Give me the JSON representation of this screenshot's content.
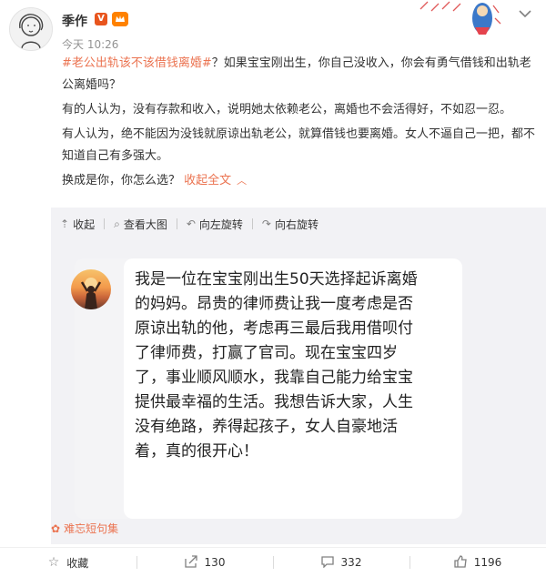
{
  "post": {
    "username": "季作",
    "badge_verified": "V",
    "badge_member": "会员",
    "timestamp": "今天 10:26",
    "topic_tag": "#老公出轨该不该借钱离婚#",
    "para1_rest": "？如果宝宝刚出生，你自己没收入，你会有勇气借钱和出轨老公离婚吗？",
    "para2": "有的人认为，没有存款和收入，说明她太依赖老公，离婚也不会活得好，不如忍一忍。",
    "para3": "有人认为，绝不能因为没钱就原谅出轨老公，就算借钱也要离婚。女人不逼自己一把，都不知道自己有多强大。",
    "para4_prefix": "换成是你，你怎么选？",
    "collapse_link": "收起全文",
    "collapse_icon": "chevron-up-icon"
  },
  "media_toolbar": {
    "collapse": "收起",
    "view_large": "查看大图",
    "rotate_left": "向左旋转",
    "rotate_right": "向右旋转"
  },
  "image_card": {
    "message": "我是一位在宝宝刚出生50天选择起诉离婚\n的妈妈。昂贵的律师费让我一度考虑是否\n原谅出轨的他，考虑再三最后我用借呗付\n了律师费，打赢了官司。现在宝宝四岁\n了，事业顺风顺水，我靠自己能力给宝宝\n提供最幸福的生活。我想告诉大家，人生\n没有绝路，养得起孩子，女人自豪地活\n着，真的很开心！"
  },
  "collection": {
    "label": "难忘短句集",
    "icon": "flower-icon"
  },
  "actions": [
    {
      "label": "收藏",
      "icon": "star-icon"
    },
    {
      "label": "130",
      "icon": "share-icon"
    },
    {
      "label": "332",
      "icon": "comment-icon"
    },
    {
      "label": "1196",
      "icon": "like-icon"
    }
  ],
  "colors": {
    "link": "#eb7350",
    "badge_v": "#e8551e",
    "badge_member": "#ff8200",
    "media_bg": "#f2f2f5",
    "muted": "#939393"
  }
}
